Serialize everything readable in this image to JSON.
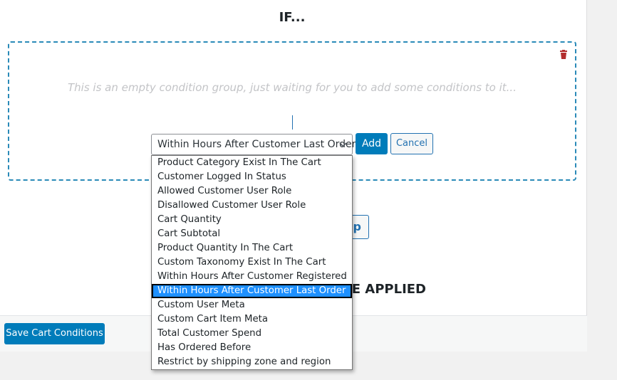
{
  "if_title": "IF...",
  "empty_message": "This is an empty condition group, just waiting for you to add some conditions to it...",
  "select": {
    "value": "Within Hours After Customer Last Order",
    "options": [
      "Product Category Exist In The Cart",
      "Customer Logged In Status",
      "Allowed Customer User Role",
      "Disallowed Customer User Role",
      "Cart Quantity",
      "Cart Subtotal",
      "Product Quantity In The Cart",
      "Custom Taxonomy Exist In The Cart",
      "Within Hours After Customer Registered",
      "Within Hours After Customer Last Order",
      "Custom User Meta",
      "Custom Cart Item Meta",
      "Total Customer Spend",
      "Has Ordered Before",
      "Restrict by shipping zone and region"
    ],
    "selected_index": 9
  },
  "add_label": "Add",
  "cancel_label": "Cancel",
  "add_group_label_visible": "up",
  "then_title_visible": "BE APPLIED",
  "save_label": "Save Cart Conditions",
  "colors": {
    "accent": "#007cba",
    "dashed_border": "#2a8ab8",
    "trash": "#b32d2e",
    "highlight": "#1e90ff"
  }
}
